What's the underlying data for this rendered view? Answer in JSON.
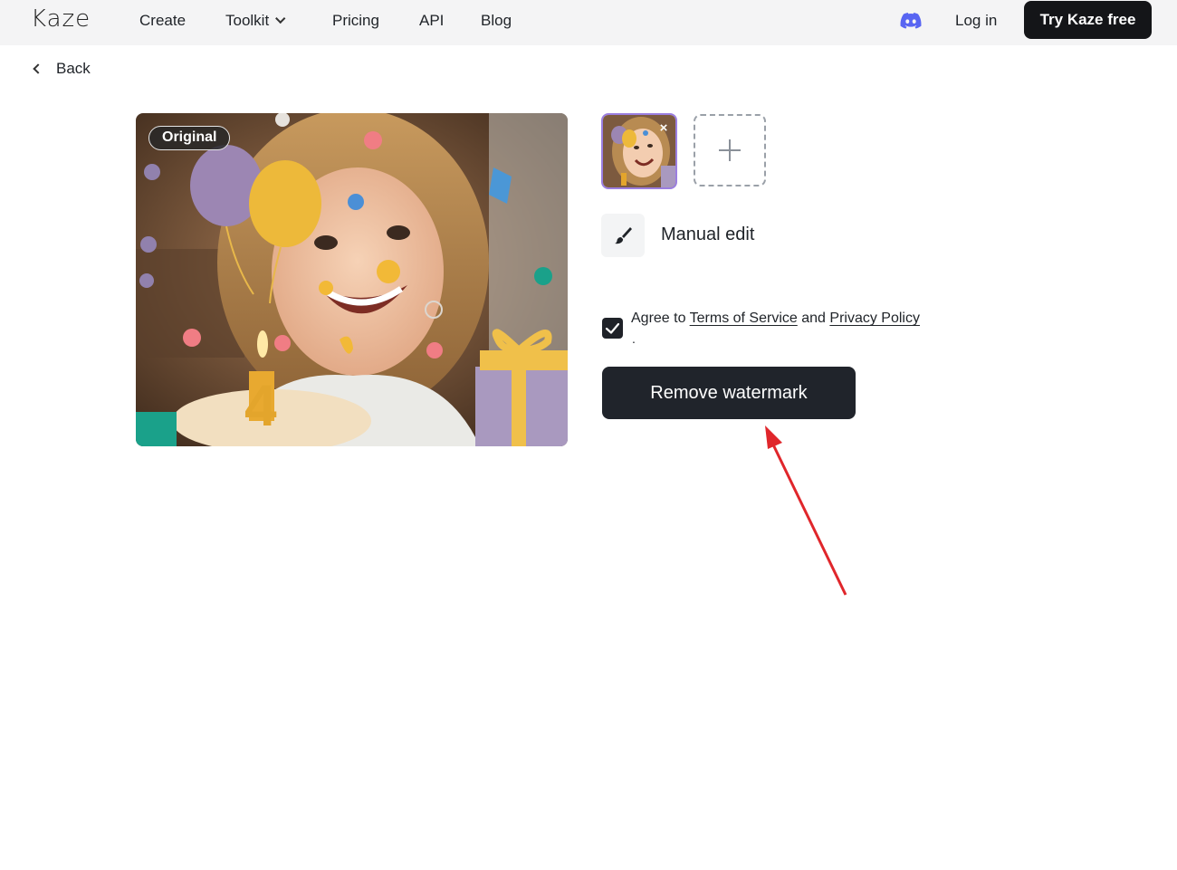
{
  "header": {
    "logo": "Kaze",
    "nav": {
      "create": "Create",
      "toolkit": "Toolkit",
      "pricing": "Pricing",
      "api": "API",
      "blog": "Blog"
    },
    "discord_icon": "discord-icon",
    "login": "Log in",
    "cta": "Try Kaze free"
  },
  "back": {
    "label": "Back",
    "icon": "chevron-left-icon"
  },
  "preview": {
    "badge": "Original"
  },
  "tools": {
    "thumbnail_close": "×",
    "add_icon": "plus-icon",
    "manual_edit": {
      "icon": "brush-icon",
      "label": "Manual edit"
    }
  },
  "agreement": {
    "checked": true,
    "prefix": "Agree to",
    "terms": "Terms of Service",
    "and": "and",
    "privacy": "Privacy Policy",
    "trailing": "."
  },
  "action": {
    "label": "Remove watermark"
  },
  "colors": {
    "accent_dark": "#20242b",
    "annotation_arrow": "#e0262b",
    "thumbnail_border": "#9b7ee0",
    "discord": "#5865f2"
  }
}
